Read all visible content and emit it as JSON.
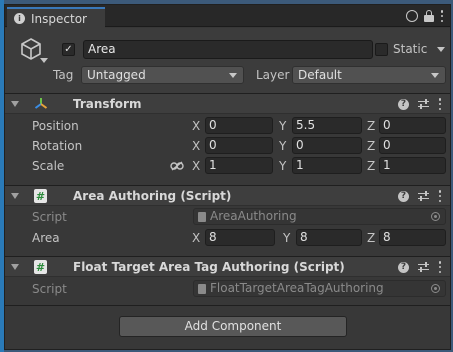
{
  "window": {
    "tab_title": "Inspector"
  },
  "gameobject": {
    "name": "Area",
    "active": true,
    "static_label": "Static",
    "static": false,
    "tag_label": "Tag",
    "tag_value": "Untagged",
    "layer_label": "Layer",
    "layer_value": "Default"
  },
  "transform": {
    "title": "Transform",
    "position": {
      "label": "Position",
      "x": "0",
      "y": "5.5",
      "z": "0"
    },
    "rotation": {
      "label": "Rotation",
      "x": "0",
      "y": "0",
      "z": "0"
    },
    "scale": {
      "label": "Scale",
      "x": "1",
      "y": "1",
      "z": "1"
    }
  },
  "axes": {
    "x": "X",
    "y": "Y",
    "z": "Z"
  },
  "area_authoring": {
    "title": "Area Authoring (Script)",
    "script_label": "Script",
    "script_value": "AreaAuthoring",
    "area_label": "Area",
    "x": "8",
    "y": "8",
    "z": "8"
  },
  "float_target": {
    "title": "Float Target Area Tag Authoring (Script)",
    "script_label": "Script",
    "script_value": "FloatTargetAreaTagAuthoring"
  },
  "add_component_label": "Add Component",
  "colors": {
    "accent": "#3a79bb",
    "panel": "#383838",
    "header": "#3e3e3e"
  }
}
